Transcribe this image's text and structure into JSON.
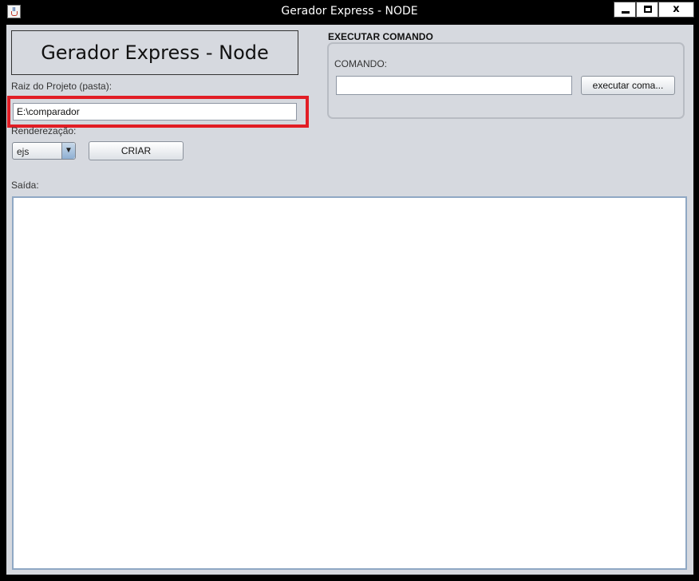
{
  "window": {
    "title": "Gerador Express - NODE",
    "close_glyph": "x"
  },
  "header": {
    "title": "Gerador Express - Node"
  },
  "project": {
    "root_label": "Raiz do Projeto (pasta):",
    "root_value": "E:\\comparador",
    "render_label": "Renderezação:",
    "render_selected": "ejs",
    "create_button": "CRIAR"
  },
  "command": {
    "group_title": "EXECUTAR COMANDO",
    "label": "COMANDO:",
    "value": "",
    "execute_button": "executar coma..."
  },
  "output": {
    "label": "Saída:",
    "value": ""
  },
  "colors": {
    "highlight": "#e21d25",
    "client_background": "#d6d9df"
  }
}
